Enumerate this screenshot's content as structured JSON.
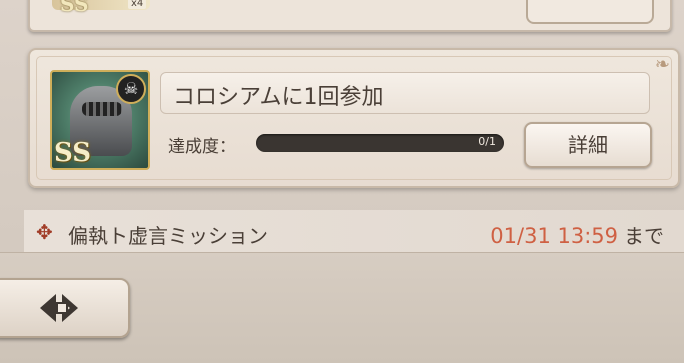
{
  "top_card": {
    "rank_label": "SS",
    "multiplier": "x4"
  },
  "mission": {
    "title": "コロシアムに1回参加",
    "rank_label": "SS",
    "progress_label": "達成度：",
    "progress_text": "0/1",
    "progress_current": 0,
    "progress_total": 1,
    "detail_button": "詳細"
  },
  "section": {
    "name": "偏執ト虚言ミッション",
    "deadline": "01/31 13:59",
    "until": "まで"
  },
  "icons": {
    "section_icon": "cross-icon",
    "avatar_badge": "skull-icon",
    "back": "back-arrow-icon"
  },
  "colors": {
    "deadline": "#cf6043",
    "section_icon": "#a13c27",
    "progress_track": "#3a3531"
  }
}
